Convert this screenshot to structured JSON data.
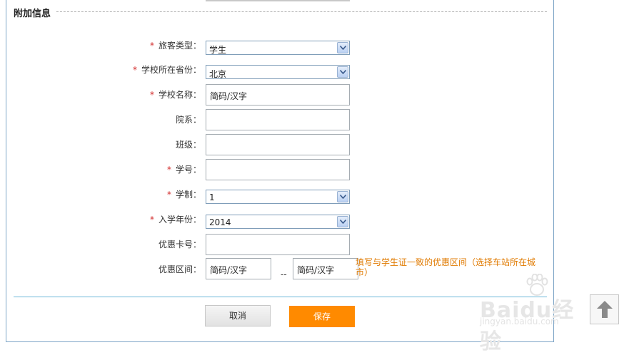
{
  "section": {
    "title": "附加信息"
  },
  "form": {
    "passenger_type": {
      "label": "旅客类型：",
      "value": "学生",
      "required": "*"
    },
    "school_province": {
      "label": "学校所在省份：",
      "value": "北京",
      "required": "*"
    },
    "school_name": {
      "label": "学校名称：",
      "value": "简码/汉字",
      "required": "*"
    },
    "department": {
      "label": "院系：",
      "value": ""
    },
    "class": {
      "label": "班级：",
      "value": ""
    },
    "student_id": {
      "label": "学号：",
      "value": "",
      "required": "*"
    },
    "program_length": {
      "label": "学制：",
      "value": "1",
      "required": "*"
    },
    "enroll_year": {
      "label": "入学年份：",
      "value": "2014",
      "required": "*"
    },
    "discount_card": {
      "label": "优惠卡号：",
      "value": ""
    },
    "discount_range": {
      "label": "优惠区间：",
      "from_value": "简码/汉字",
      "separator": "--",
      "to_value": "简码/汉字",
      "hint": "填写与学生证一致的优惠区间（选择车站所在城市）"
    }
  },
  "buttons": {
    "cancel": "取消",
    "save": "保存"
  },
  "watermark": {
    "brand": "Baidu经验",
    "url": "jingyan.baidu.com"
  },
  "colors": {
    "required": "#d22b2b",
    "save_button": "#ff8a00",
    "hint": "#e07a00",
    "frame_border": "#7fa6c7"
  }
}
